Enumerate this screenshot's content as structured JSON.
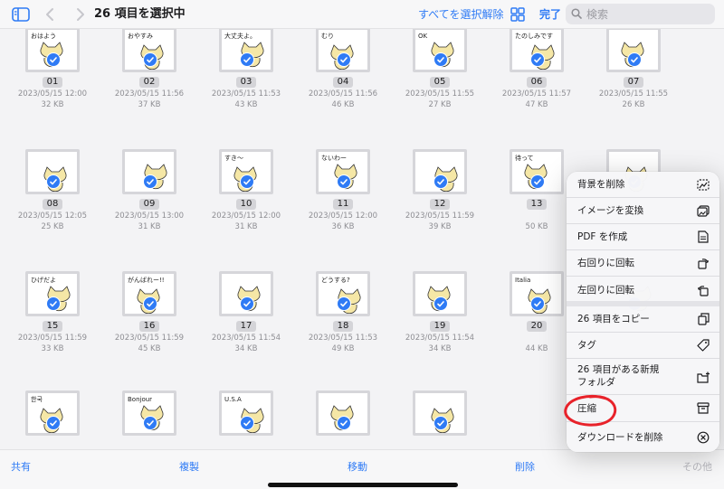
{
  "header": {
    "title": "26 項目を選択中",
    "deselect_all": "すべてを選択解除",
    "done": "完了",
    "search_placeholder": "検索"
  },
  "files": [
    {
      "name": "01",
      "date": "2023/05/15 12:00",
      "size": "32 KB",
      "caption": "おはよう"
    },
    {
      "name": "02",
      "date": "2023/05/15 11:56",
      "size": "37 KB",
      "caption": "おやすみ"
    },
    {
      "name": "03",
      "date": "2023/05/15 11:53",
      "size": "43 KB",
      "caption": "大丈夫よ。"
    },
    {
      "name": "04",
      "date": "2023/05/15 11:56",
      "size": "46 KB",
      "caption": "むり"
    },
    {
      "name": "05",
      "date": "2023/05/15 11:55",
      "size": "27 KB",
      "caption": "OK"
    },
    {
      "name": "06",
      "date": "2023/05/15 11:57",
      "size": "47 KB",
      "caption": "たのしみです"
    },
    {
      "name": "07",
      "date": "2023/05/15 11:55",
      "size": "26 KB",
      "caption": ""
    },
    {
      "name": "08",
      "date": "2023/05/15 12:05",
      "size": "25 KB",
      "caption": ""
    },
    {
      "name": "09",
      "date": "2023/05/15 13:00",
      "size": "31 KB",
      "caption": ""
    },
    {
      "name": "10",
      "date": "2023/05/15 12:00",
      "size": "31 KB",
      "caption": "すき〜"
    },
    {
      "name": "11",
      "date": "2023/05/15 12:00",
      "size": "36 KB",
      "caption": "ないわー"
    },
    {
      "name": "12",
      "date": "2023/05/15 11:59",
      "size": "39 KB",
      "caption": ""
    },
    {
      "name": "13",
      "date": "",
      "size": "50 KB",
      "caption": "待って"
    },
    {
      "name": "",
      "date": "",
      "size": "",
      "caption": ""
    },
    {
      "name": "15",
      "date": "2023/05/15 11:59",
      "size": "33 KB",
      "caption": "ひげだよ"
    },
    {
      "name": "16",
      "date": "2023/05/15 11:59",
      "size": "45 KB",
      "caption": "がんばれー!!"
    },
    {
      "name": "17",
      "date": "2023/05/15 11:54",
      "size": "34 KB",
      "caption": ""
    },
    {
      "name": "18",
      "date": "2023/05/15 11:53",
      "size": "49 KB",
      "caption": "どうする?"
    },
    {
      "name": "19",
      "date": "2023/05/15 11:54",
      "size": "34 KB",
      "caption": ""
    },
    {
      "name": "20",
      "date": "",
      "size": "44 KB",
      "caption": "Italia"
    },
    {
      "name": "",
      "date": "",
      "size": "",
      "caption": ""
    },
    {
      "name": "",
      "date": "",
      "size": "",
      "caption": "한국"
    },
    {
      "name": "",
      "date": "",
      "size": "",
      "caption": "Bonjour"
    },
    {
      "name": "",
      "date": "",
      "size": "",
      "caption": "U.S.A"
    },
    {
      "name": "",
      "date": "",
      "size": "",
      "caption": ""
    },
    {
      "name": "",
      "date": "",
      "size": "",
      "caption": ""
    }
  ],
  "menu": {
    "items": [
      {
        "label": "背景を削除",
        "icon": "remove-background-icon"
      },
      {
        "label": "イメージを変換",
        "icon": "convert-image-icon"
      },
      {
        "label": "PDF を作成",
        "icon": "pdf-document-icon"
      },
      {
        "label": "右回りに回転",
        "icon": "rotate-right-icon"
      },
      {
        "label": "左回りに回転",
        "icon": "rotate-left-icon"
      },
      {
        "label": "26 項目をコピー",
        "icon": "copy-icon"
      },
      {
        "label": "タグ",
        "icon": "tag-icon"
      },
      {
        "label": "26 項目がある新規フォルダ",
        "icon": "new-folder-icon"
      },
      {
        "label": "圧縮",
        "icon": "archive-box-icon"
      },
      {
        "label": "ダウンロードを削除",
        "icon": "remove-download-icon"
      }
    ]
  },
  "toolbar": {
    "share": "共有",
    "duplicate": "複製",
    "move": "移動",
    "delete": "削除",
    "more": "その他"
  },
  "colors": {
    "accent": "#2f7bf5",
    "annotation": "#e8222a"
  }
}
